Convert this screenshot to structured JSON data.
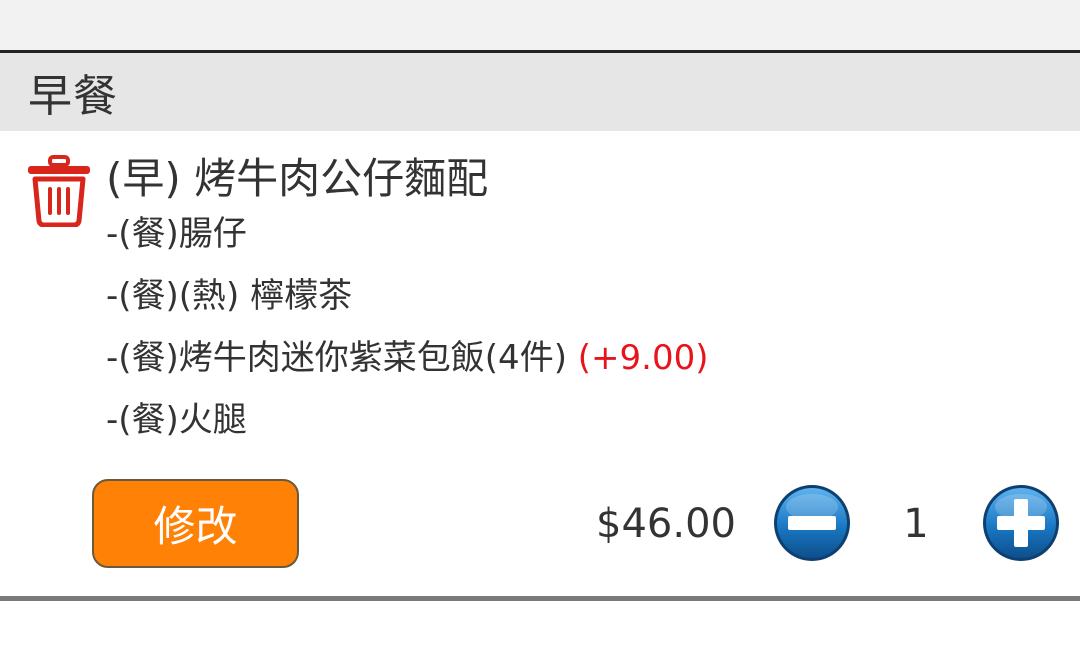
{
  "category": {
    "title": "早餐"
  },
  "item": {
    "name": "(早) 烤牛肉公仔麵配",
    "options": [
      {
        "text": "-(餐)腸仔",
        "surcharge": ""
      },
      {
        "text": "-(餐)(熱) 檸檬茶",
        "surcharge": ""
      },
      {
        "text": "-(餐)烤牛肉迷你紫菜包飯(4件) ",
        "surcharge": "(+9.00)"
      },
      {
        "text": "-(餐)火腿",
        "surcharge": ""
      }
    ],
    "edit_label": "修改",
    "price": "$46.00",
    "quantity": "1"
  },
  "icons": {
    "delete": "trash-icon",
    "decrease": "minus-circle-icon",
    "increase": "plus-circle-icon"
  },
  "colors": {
    "edit_button": "#ff8106",
    "surcharge": "#e8141b",
    "trash": "#d9261c",
    "qty_button": "#1877c2"
  }
}
